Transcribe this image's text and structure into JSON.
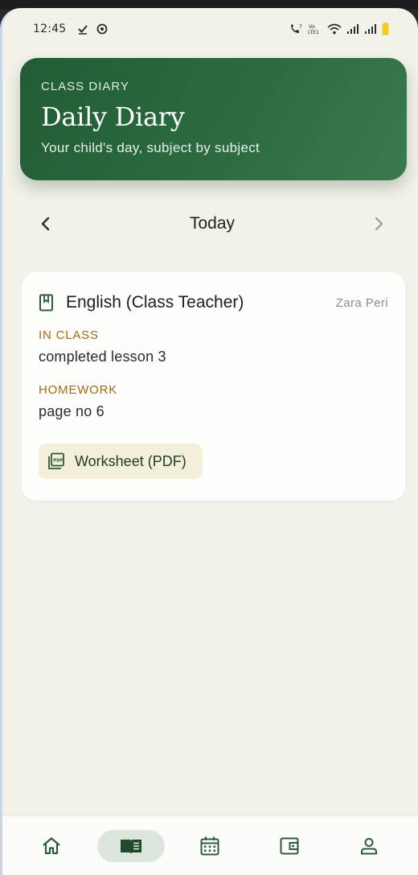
{
  "status_bar": {
    "time": "12:45",
    "icons": [
      "check-icon",
      "circle-status-icon",
      "call-icon",
      "volte-icon",
      "wifi-icon",
      "signal-icon",
      "signal-icon",
      "battery-icon"
    ],
    "volte_label": "Vo LTE1"
  },
  "header": {
    "eyebrow": "CLASS DIARY",
    "title": "Daily Diary",
    "subtitle": "Your child's day, subject by subject",
    "colors": {
      "start": "#225c34",
      "end": "#3a7a4c"
    }
  },
  "date_nav": {
    "label": "Today",
    "prev_icon": "chevron-left-icon",
    "next_icon": "chevron-right-icon"
  },
  "entries": [
    {
      "icon": "book-icon",
      "subject": "English (Class Teacher)",
      "teacher": "Zara Peri",
      "in_class_label": "IN CLASS",
      "in_class_text": "completed lesson 3",
      "homework_label": "HOMEWORK",
      "homework_text": "page no 6",
      "attachment": {
        "icon": "pdf-icon",
        "label": "Worksheet (PDF)"
      }
    }
  ],
  "bottom_nav": {
    "items": [
      {
        "icon": "home-icon",
        "active": false
      },
      {
        "icon": "diary-icon",
        "active": true
      },
      {
        "icon": "calendar-icon",
        "active": false
      },
      {
        "icon": "wallet-icon",
        "active": false
      },
      {
        "icon": "profile-icon",
        "active": false
      }
    ]
  },
  "colors": {
    "accent_green": "#2c6b40",
    "label_amber": "#a06a13",
    "background": "#f2f1ea",
    "attachment_bg": "#f4efdb"
  }
}
